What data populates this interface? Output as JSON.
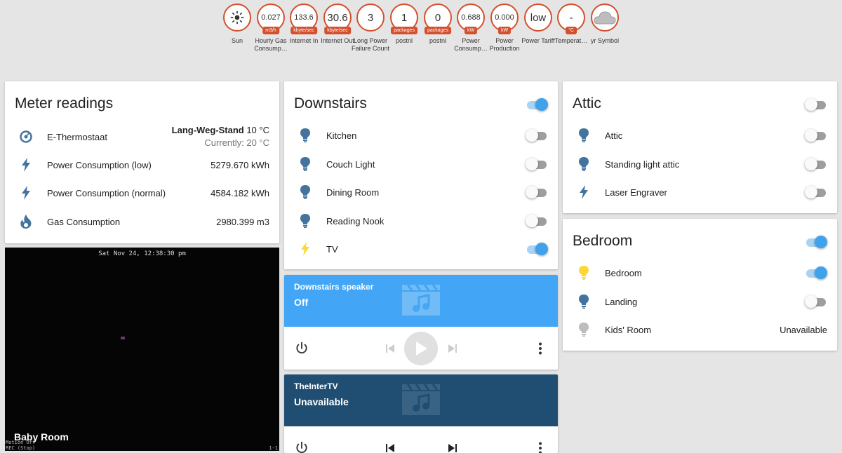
{
  "badges": [
    {
      "value": "",
      "unit": "",
      "label": "Sun",
      "icon": "sun-icon"
    },
    {
      "value": "0.027",
      "unit": "m3/h",
      "label": "Hourly Gas Consump…"
    },
    {
      "value": "133.6",
      "unit": "kbyte/sec",
      "label": "Internet In"
    },
    {
      "value": "30.6",
      "unit": "kbyte/sec",
      "label": "Internet Out"
    },
    {
      "value": "3",
      "unit": "",
      "label": "Long Power Failure Count"
    },
    {
      "value": "1",
      "unit": "packages",
      "label": "postnl"
    },
    {
      "value": "0",
      "unit": "packages",
      "label": "postnl"
    },
    {
      "value": "0.688",
      "unit": "kW",
      "label": "Power Consump…"
    },
    {
      "value": "0.000",
      "unit": "kW",
      "label": "Power Production"
    },
    {
      "value": "low",
      "unit": "",
      "label": "Power Tariff"
    },
    {
      "value": "-",
      "unit": "°C",
      "label": "Temperat…"
    },
    {
      "value": "",
      "unit": "",
      "label": "yr Symbol",
      "icon": "cloud-icon"
    }
  ],
  "meter": {
    "title": "Meter readings",
    "thermostat": {
      "name": "E-Thermostaat",
      "mode": "Lang-Weg-Stand",
      "setpoint": "10 °C",
      "current": "Currently: 20 °C"
    },
    "rows": [
      {
        "name": "Power Consumption (low)",
        "value": "5279.670 kWh"
      },
      {
        "name": "Power Consumption (normal)",
        "value": "4584.182 kWh"
      },
      {
        "name": "Gas Consumption",
        "value": "2980.399 m3"
      }
    ]
  },
  "camera": {
    "timestamp": "Sat Nov 24, 12:38:30 pm",
    "title": "Baby Room",
    "motion": "Motion Off",
    "rec": "REC (Stop)",
    "frame": "1-1"
  },
  "downstairs": {
    "title": "Downstairs",
    "master_on": true,
    "rows": [
      {
        "name": "Kitchen",
        "on": false
      },
      {
        "name": "Couch Light",
        "on": false
      },
      {
        "name": "Dining Room",
        "on": false
      },
      {
        "name": "Reading Nook",
        "on": false
      },
      {
        "name": "TV",
        "on": true
      }
    ]
  },
  "speaker": {
    "name": "Downstairs speaker",
    "state": "Off"
  },
  "tv": {
    "name": "TheInterTV",
    "state": "Unavailable"
  },
  "attic": {
    "title": "Attic",
    "master_on": false,
    "rows": [
      {
        "name": "Attic",
        "on": false
      },
      {
        "name": "Standing light attic",
        "on": false
      },
      {
        "name": "Laser Engraver",
        "on": false
      }
    ]
  },
  "bedroom": {
    "title": "Bedroom",
    "master_on": true,
    "rows": [
      {
        "name": "Bedroom",
        "on": true
      },
      {
        "name": "Landing",
        "on": false
      },
      {
        "name": "Kids' Room",
        "value": "Unavailable"
      }
    ]
  },
  "colors": {
    "accent": "#41a2ec",
    "badge_border": "#d3502e",
    "icon_blue": "#44739e",
    "icon_yellow": "#fdd835",
    "speaker_bg": "#42a5f5",
    "tv_bg": "#1f4e72"
  }
}
